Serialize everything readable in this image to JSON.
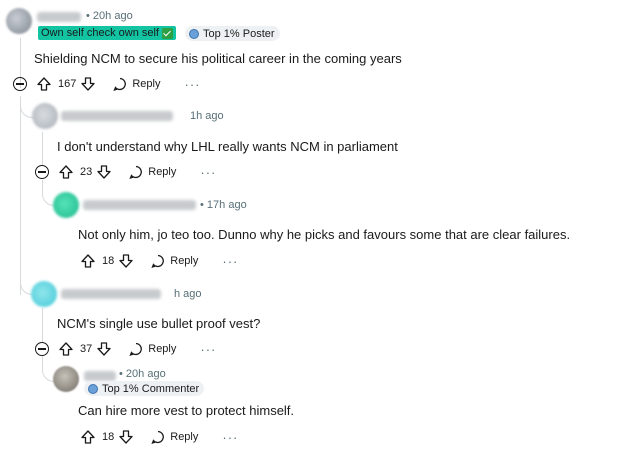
{
  "comments": [
    {
      "time": "20h ago",
      "flair": "Own self check own self",
      "badge": "Top 1% Poster",
      "text": "Shielding NCM to secure his political career in the coming years",
      "votes": "167",
      "reply": "Reply",
      "more": "···"
    },
    {
      "time": "1h ago",
      "text": "I don't understand why LHL really wants NCM in parliament",
      "votes": "23",
      "reply": "Reply",
      "more": "···"
    },
    {
      "time": "17h ago",
      "text": "Not only him, jo teo too. Dunno why he picks and favours some that are clear failures.",
      "votes": "18",
      "reply": "Reply",
      "more": "···"
    },
    {
      "time": "h ago",
      "text": "NCM's single use bullet proof vest?",
      "votes": "37",
      "reply": "Reply",
      "more": "···"
    },
    {
      "time": "20h ago",
      "badge": "Top 1% Commenter",
      "text": "Can hire more vest to protect himself.",
      "votes": "18",
      "reply": "Reply",
      "more": "···"
    }
  ],
  "separator": "•",
  "colors": {
    "flair_green": "#13c4a3",
    "meta": "#576f76",
    "thread_line": "#d7dadc"
  }
}
